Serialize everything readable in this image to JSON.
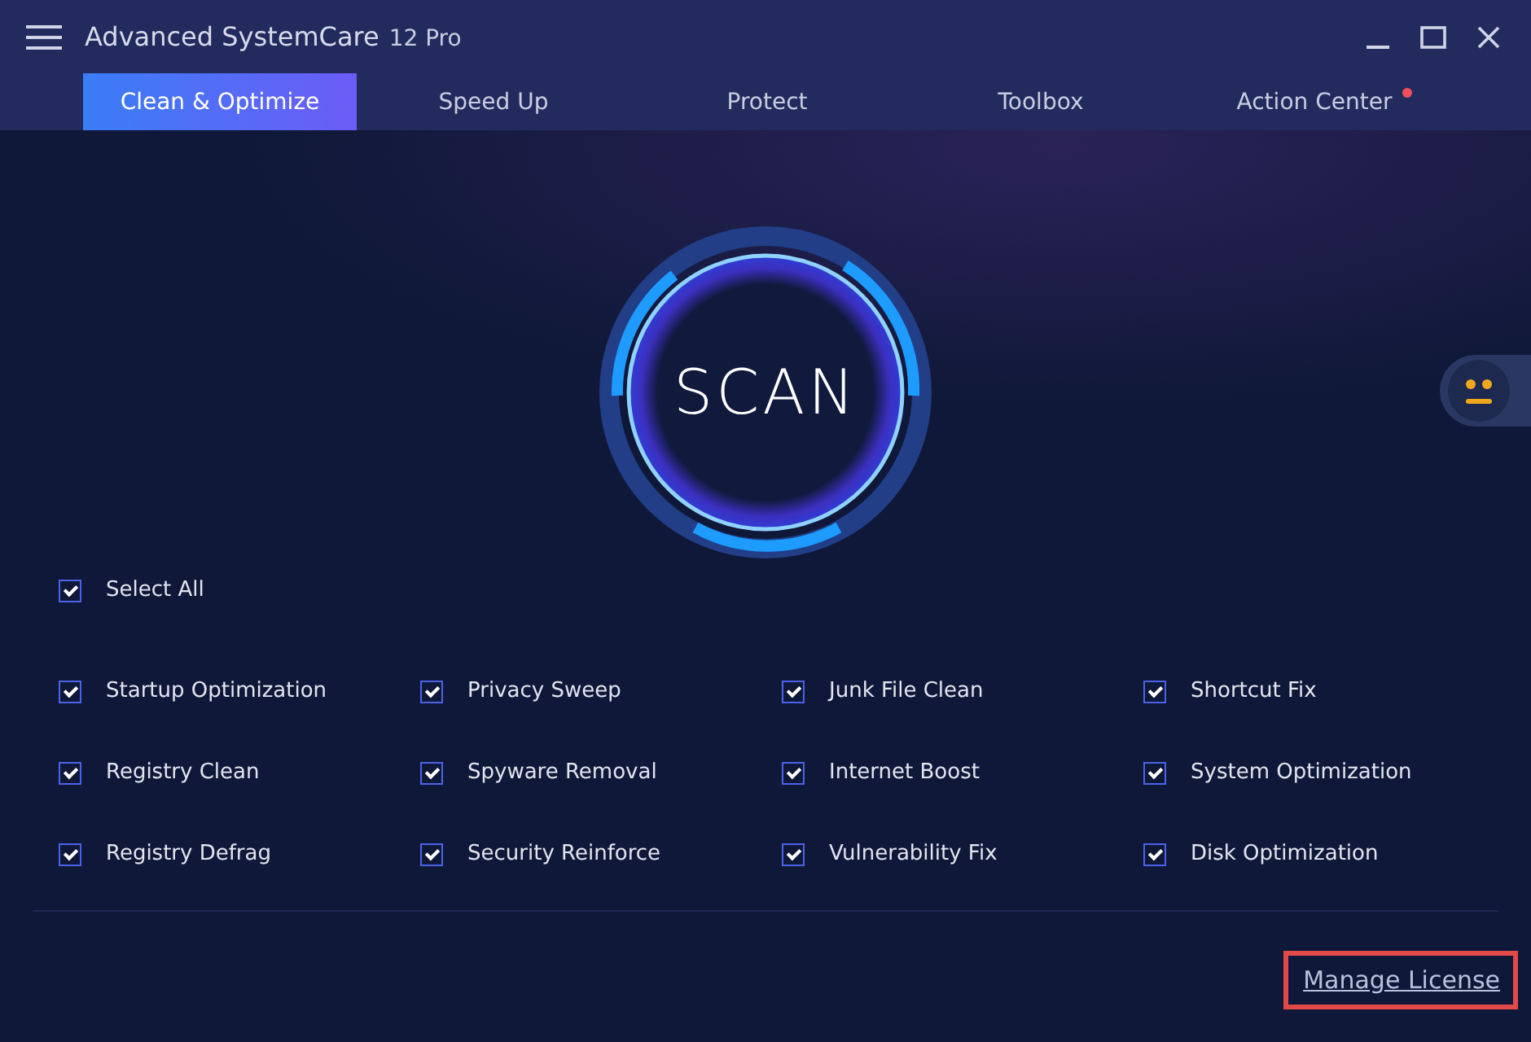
{
  "window": {
    "title": "Advanced SystemCare",
    "edition": "12 Pro"
  },
  "tabs": [
    {
      "label": "Clean & Optimize",
      "selected": true,
      "badge": false
    },
    {
      "label": "Speed Up",
      "selected": false,
      "badge": false
    },
    {
      "label": "Protect",
      "selected": false,
      "badge": false
    },
    {
      "label": "Toolbox",
      "selected": false,
      "badge": false
    },
    {
      "label": "Action Center",
      "selected": false,
      "badge": true
    }
  ],
  "scan_button": {
    "label": "SCAN"
  },
  "select_all": {
    "label": "Select All",
    "checked": true
  },
  "options": [
    {
      "label": "Startup Optimization",
      "checked": true
    },
    {
      "label": "Privacy Sweep",
      "checked": true
    },
    {
      "label": "Junk File Clean",
      "checked": true
    },
    {
      "label": "Shortcut Fix",
      "checked": true
    },
    {
      "label": "Registry Clean",
      "checked": true
    },
    {
      "label": "Spyware Removal",
      "checked": true
    },
    {
      "label": "Internet Boost",
      "checked": true
    },
    {
      "label": "System Optimization",
      "checked": true
    },
    {
      "label": "Registry Defrag",
      "checked": true
    },
    {
      "label": "Security Reinforce",
      "checked": true
    },
    {
      "label": "Vulnerability Fix",
      "checked": true
    },
    {
      "label": "Disk Optimization",
      "checked": true
    }
  ],
  "footer": {
    "link": "Manage License",
    "highlighted": true
  }
}
